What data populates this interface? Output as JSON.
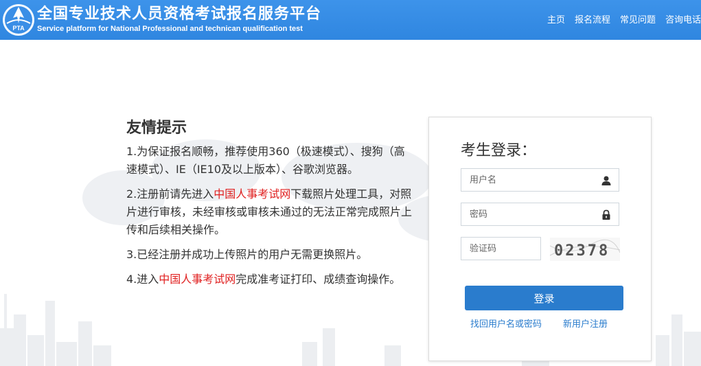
{
  "header": {
    "title": "全国专业技术人员资格考试报名服务平台",
    "subtitle": "Service platform for National Professional and technican qualification test",
    "logo_text": "PTA",
    "logo_icon": "pta-logo",
    "nav": [
      {
        "label": "主页"
      },
      {
        "label": "报名流程"
      },
      {
        "label": "常见问题"
      },
      {
        "label": "咨询电话"
      }
    ]
  },
  "tips": {
    "title": "友情提示",
    "items": [
      {
        "parts": [
          "1.为保证报名顺畅，推荐使用360（极速模式）、搜狗（高速模式）、IE（IE10及以上版本）、谷歌浏览器。"
        ]
      },
      {
        "before": "2.注册前请先进入",
        "link": "中国人事考试网",
        "after": "下载照片处理工具，对照片进行审核，未经审核或审核未通过的无法正常完成照片上传和后续相关操作。"
      },
      {
        "parts": [
          "3.已经注册并成功上传照片的用户无需更换照片。"
        ]
      },
      {
        "before": "4.进入",
        "link": "中国人事考试网",
        "after": "完成准考证打印、成绩查询操作。"
      }
    ],
    "link_color": "#e02020"
  },
  "login": {
    "title": "考生登录：",
    "username_placeholder": "用户名",
    "password_placeholder": "密码",
    "captcha_placeholder": "验证码",
    "captcha_text": "02378",
    "submit_label": "登录",
    "forgot_label": "找回用户名或密码",
    "register_label": "新用户注册",
    "accent_color": "#2a7ccd",
    "username_icon": "user-icon",
    "password_icon": "lock-icon"
  },
  "colors": {
    "header_bg": "#3a8ee6",
    "link": "#2a7ccd"
  }
}
